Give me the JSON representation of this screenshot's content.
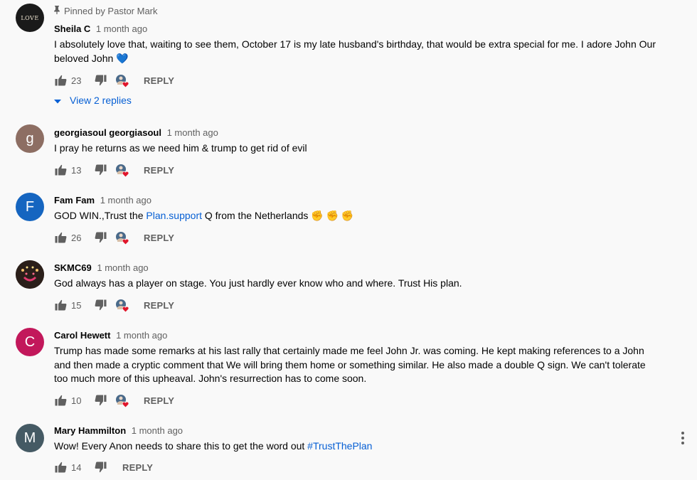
{
  "comments": [
    {
      "pinned_label": "Pinned by Pastor Mark",
      "avatar_text": "LOVE",
      "avatar_color": "#1a1a1a",
      "author": "Sheila C",
      "time": "1 month ago",
      "text": "I absolutely love that, waiting to see them, October 17 is my late husband's birthday, that would be extra special for me. I adore John Our beloved John 💙",
      "likes": "23",
      "reply_label": "REPLY",
      "view_replies": "View 2 replies"
    },
    {
      "avatar_text": "g",
      "avatar_color": "#8d6e63",
      "author": "georgiasoul georgiasoul",
      "time": "1 month ago",
      "text": "I pray he returns as we need him & trump to get rid of evil",
      "likes": "13",
      "reply_label": "REPLY"
    },
    {
      "avatar_text": "F",
      "avatar_color": "#1565c0",
      "author": "Fam Fam",
      "time": "1 month ago",
      "text_before": "GOD WIN.,Trust the ",
      "text_link": "Plan.support",
      "text_after": " Q from the Netherlands ✊ ✊ ✊",
      "likes": "26",
      "reply_label": "REPLY"
    },
    {
      "avatar_text": "",
      "avatar_color": "#2b1f1a",
      "author": "SKMC69",
      "time": "1 month ago",
      "text": "God always has a player on stage. You just hardly ever know who and where. Trust His plan.",
      "likes": "15",
      "reply_label": "REPLY"
    },
    {
      "avatar_text": "C",
      "avatar_color": "#c2185b",
      "author": "Carol Hewett",
      "time": "1 month ago",
      "text": "Trump has made some remarks at his last rally  that certainly  made me feel John Jr. was coming. He kept making references to a John and then made a cryptic comment that We will bring them home or something similar. He also made a double Q sign. We can't tolerate too much more of this upheaval.  John's resurrection has to come soon.",
      "likes": "10",
      "reply_label": "REPLY"
    },
    {
      "avatar_text": "M",
      "avatar_color": "#455a64",
      "author": "Mary Hammilton",
      "time": "1 month ago",
      "text_before": "Wow! Every Anon needs to share this to get the word out ",
      "text_link": "#TrustThePlan",
      "likes": "14",
      "reply_label": "REPLY"
    }
  ]
}
